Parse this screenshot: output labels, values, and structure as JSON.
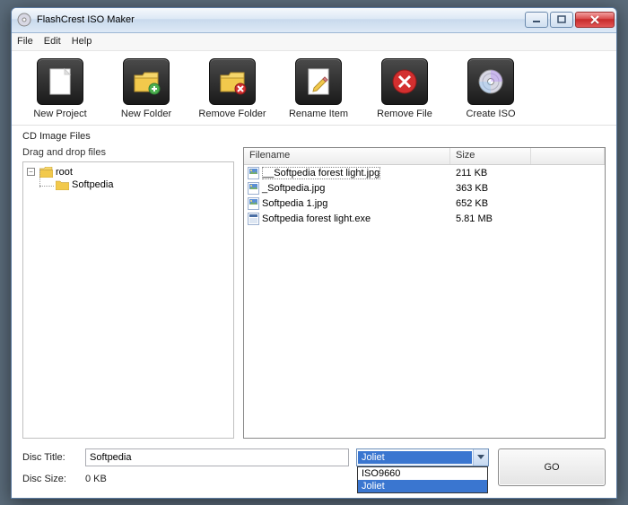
{
  "title": "FlashCrest ISO Maker",
  "menu": {
    "file": "File",
    "edit": "Edit",
    "help": "Help"
  },
  "tools": {
    "new_project": "New Project",
    "new_folder": "New Folder",
    "remove_folder": "Remove Folder",
    "rename_item": "Rename Item",
    "remove_file": "Remove File",
    "create_iso": "Create ISO"
  },
  "section_label": "CD Image Files",
  "tree_hint": "Drag and drop files",
  "tree": {
    "root": "root",
    "child": "Softpedia"
  },
  "list": {
    "cols": {
      "name": "Filename",
      "size": "Size"
    },
    "rows": [
      {
        "name": "__Softpedia forest light.jpg",
        "size": "211 KB",
        "type": "img"
      },
      {
        "name": "_Softpedia.jpg",
        "size": "363 KB",
        "type": "img"
      },
      {
        "name": "Softpedia 1.jpg",
        "size": "652 KB",
        "type": "img"
      },
      {
        "name": "Softpedia forest light.exe",
        "size": "5.81 MB",
        "type": "exe"
      }
    ]
  },
  "bottom": {
    "disc_title_label": "Disc Title:",
    "disc_title_value": "Softpedia",
    "disc_size_label": "Disc Size:",
    "disc_size_value": "0 KB",
    "fs_selected": "Joliet",
    "fs_options": [
      "ISO9660",
      "Joliet"
    ],
    "go": "GO"
  }
}
